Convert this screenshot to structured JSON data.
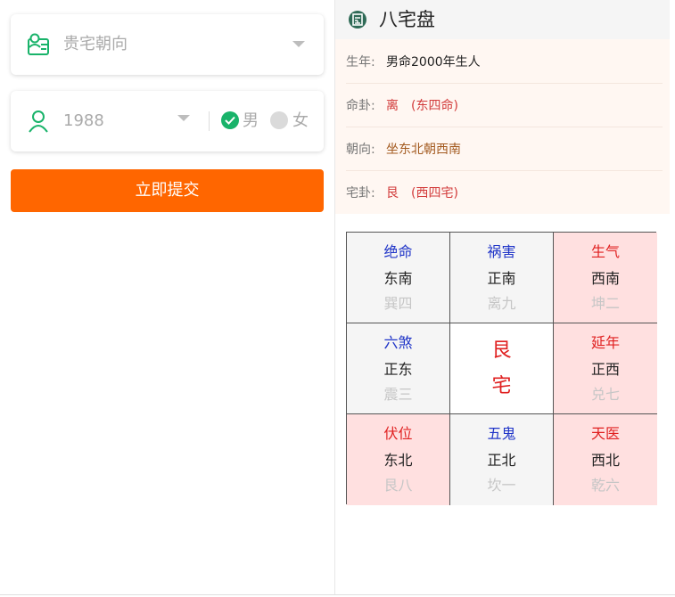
{
  "form": {
    "house_direction_placeholder": "贵宅朝向",
    "birth_year": "1988",
    "gender_male": "男",
    "gender_female": "女",
    "submit_label": "立即提交",
    "accent_color": "#ff6600",
    "check_color": "#19b36a"
  },
  "result": {
    "title": "八宅盘",
    "info": [
      {
        "label": "生年:",
        "value": "男命2000年生人",
        "value2": ""
      },
      {
        "label": "命卦:",
        "value": "离",
        "value2": "(东四命)"
      },
      {
        "label": "朝向:",
        "value": "坐东北朝西南",
        "value2": ""
      },
      {
        "label": "宅卦:",
        "value": "艮",
        "value2": "(西四宅)"
      }
    ],
    "grid": [
      {
        "star": "绝命",
        "direction": "东南",
        "trigram": "巽四"
      },
      {
        "star": "祸害",
        "direction": "正南",
        "trigram": "离九"
      },
      {
        "star": "生气",
        "direction": "西南",
        "trigram": "坤二"
      },
      {
        "star": "六煞",
        "direction": "正东",
        "trigram": "震三"
      },
      {
        "center_top": "艮",
        "center_bottom": "宅"
      },
      {
        "star": "延年",
        "direction": "正西",
        "trigram": "兑七"
      },
      {
        "star": "伏位",
        "direction": "东北",
        "trigram": "艮八"
      },
      {
        "star": "五鬼",
        "direction": "正北",
        "trigram": "坎一"
      },
      {
        "star": "天医",
        "direction": "西北",
        "trigram": "乾六"
      }
    ]
  }
}
